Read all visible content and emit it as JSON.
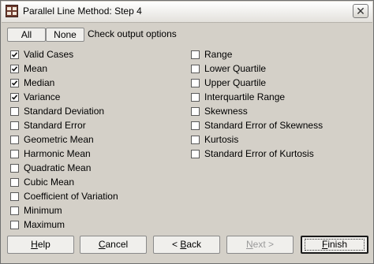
{
  "window": {
    "title": "Parallel Line Method: Step 4"
  },
  "toolbar": {
    "all_label": "All",
    "none_label": "None",
    "hint": "Check output options"
  },
  "options": {
    "left": [
      {
        "label": "Valid Cases",
        "checked": true
      },
      {
        "label": "Mean",
        "checked": true
      },
      {
        "label": "Median",
        "checked": true
      },
      {
        "label": "Variance",
        "checked": true
      },
      {
        "label": "Standard Deviation",
        "checked": false
      },
      {
        "label": "Standard Error",
        "checked": false
      },
      {
        "label": "Geometric Mean",
        "checked": false
      },
      {
        "label": "Harmonic Mean",
        "checked": false
      },
      {
        "label": "Quadratic Mean",
        "checked": false
      },
      {
        "label": "Cubic Mean",
        "checked": false
      },
      {
        "label": "Coefficient of Variation",
        "checked": false
      },
      {
        "label": "Minimum",
        "checked": false
      },
      {
        "label": "Maximum",
        "checked": false
      }
    ],
    "right": [
      {
        "label": "Range",
        "checked": false
      },
      {
        "label": "Lower Quartile",
        "checked": false
      },
      {
        "label": "Upper Quartile",
        "checked": false
      },
      {
        "label": "Interquartile Range",
        "checked": false
      },
      {
        "label": "Skewness",
        "checked": false
      },
      {
        "label": "Standard Error of Skewness",
        "checked": false
      },
      {
        "label": "Kurtosis",
        "checked": false
      },
      {
        "label": "Standard Error of Kurtosis",
        "checked": false
      }
    ]
  },
  "footer": {
    "help": {
      "mnemonic": "H",
      "rest": "elp"
    },
    "cancel": {
      "mnemonic": "C",
      "rest": "ancel"
    },
    "back": {
      "prefix": "< ",
      "mnemonic": "B",
      "rest": "ack"
    },
    "next": {
      "mnemonic": "N",
      "rest": "ext >"
    },
    "finish": {
      "mnemonic": "F",
      "rest": "inish"
    }
  }
}
